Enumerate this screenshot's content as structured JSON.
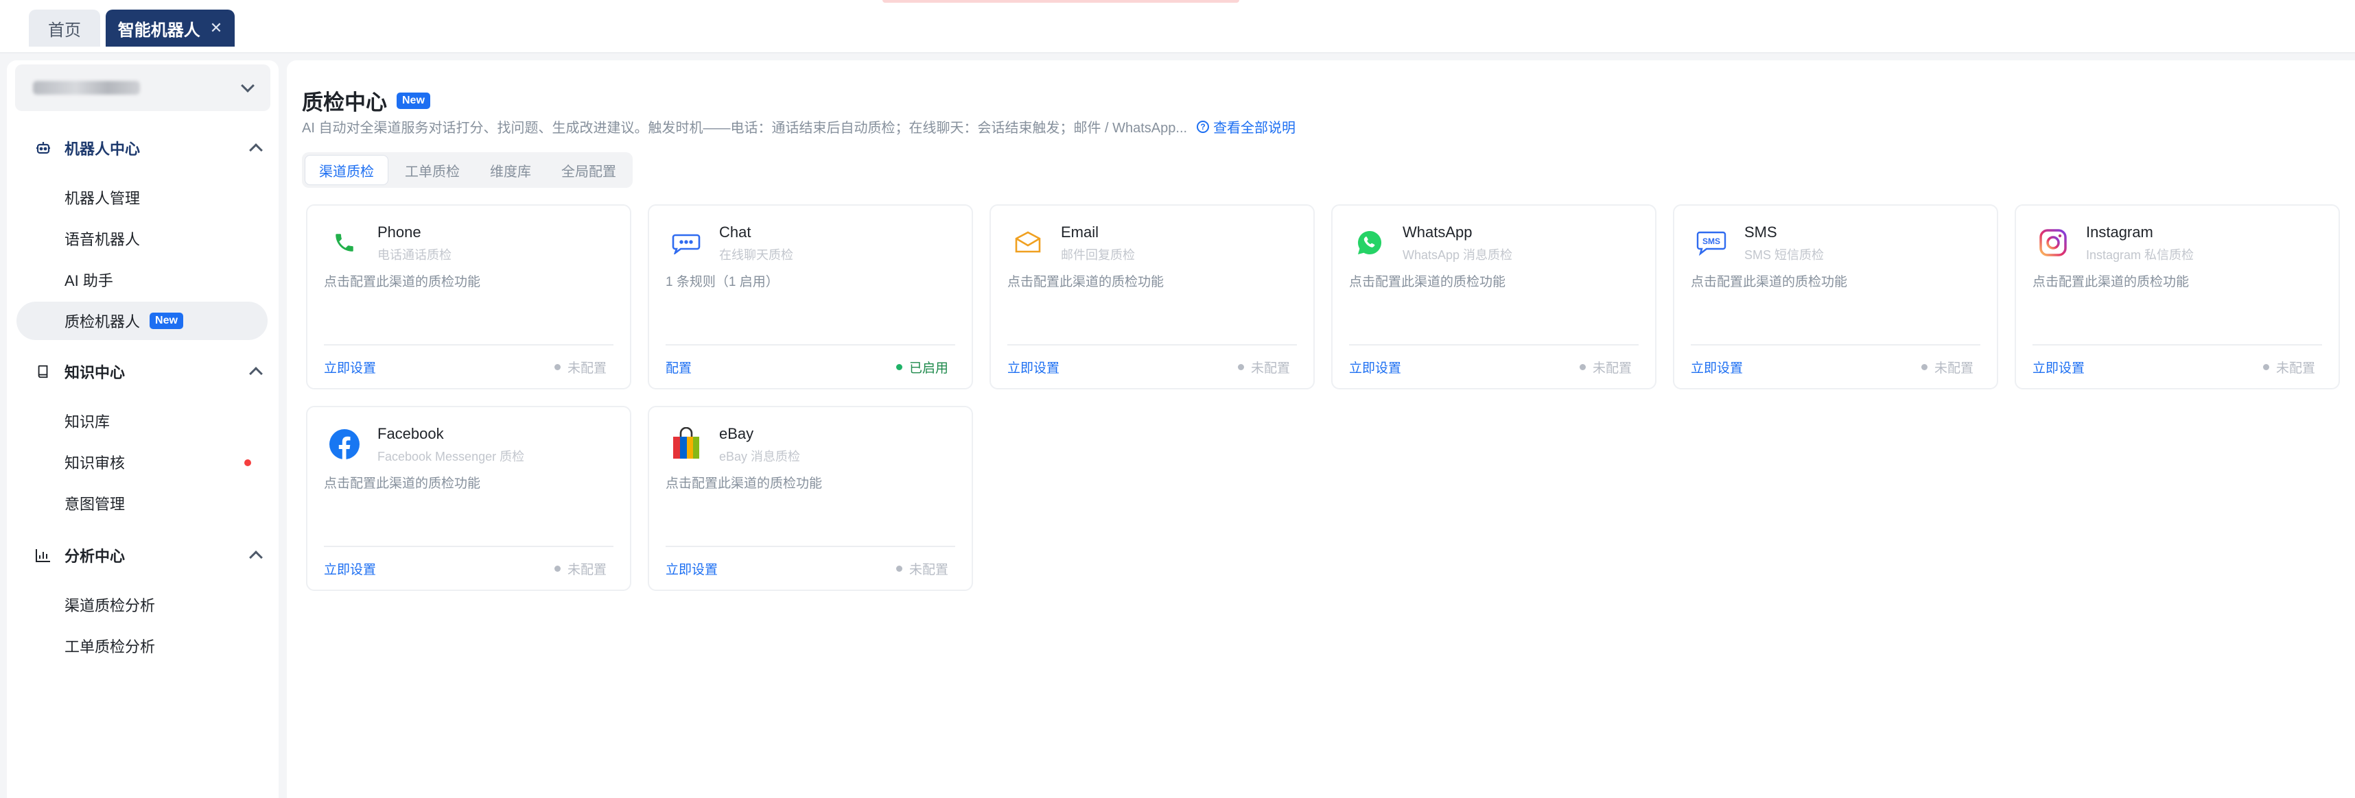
{
  "tabs": [
    {
      "label": "首页"
    },
    {
      "label": "智能机器人",
      "close": "✕"
    }
  ],
  "sidebar": {
    "groups": [
      {
        "title": "机器人中心",
        "icon": "robot-icon",
        "items": [
          {
            "label": "机器人管理"
          },
          {
            "label": "语音机器人"
          },
          {
            "label": "AI 助手"
          },
          {
            "label": "质检机器人",
            "badge": "New"
          }
        ]
      },
      {
        "title": "知识中心",
        "icon": "book-icon",
        "items": [
          {
            "label": "知识库"
          },
          {
            "label": "知识审核"
          },
          {
            "label": "意图管理"
          }
        ]
      },
      {
        "title": "分析中心",
        "icon": "bar-chart-icon",
        "items": [
          {
            "label": "渠道质检分析"
          },
          {
            "label": "工单质检分析"
          }
        ]
      }
    ]
  },
  "main": {
    "title": "质检中心",
    "title_badge": "New",
    "description": "AI 自动对全渠道服务对话打分、找问题、生成改进建议。触发时机——电话：通话结束后自动质检；在线聊天：会话结束触发；邮件 / WhatsApp...",
    "desc_link": "查看全部说明",
    "seg_tabs": [
      {
        "label": "渠道质检"
      },
      {
        "label": "工单质检"
      },
      {
        "label": "维度库"
      },
      {
        "label": "全局配置"
      }
    ],
    "cards": [
      {
        "name": "Phone",
        "sub": "电话通话质检",
        "desc": "点击配置此渠道的质检功能",
        "action": "立即设置",
        "status": "未配置",
        "icon": "phone-icon"
      },
      {
        "name": "Chat",
        "sub": "在线聊天质检",
        "desc": "1 条规则（1 启用）",
        "action": "配置",
        "status": "已启用",
        "icon": "chat-icon"
      },
      {
        "name": "Email",
        "sub": "邮件回复质检",
        "desc": "点击配置此渠道的质检功能",
        "action": "立即设置",
        "status": "未配置",
        "icon": "email-icon"
      },
      {
        "name": "WhatsApp",
        "sub": "WhatsApp 消息质检",
        "desc": "点击配置此渠道的质检功能",
        "action": "立即设置",
        "status": "未配置",
        "icon": "whatsapp-icon"
      },
      {
        "name": "SMS",
        "sub": "SMS 短信质检",
        "desc": "点击配置此渠道的质检功能",
        "action": "立即设置",
        "status": "未配置",
        "icon": "sms-icon"
      },
      {
        "name": "Instagram",
        "sub": "Instagram 私信质检",
        "desc": "点击配置此渠道的质检功能",
        "action": "立即设置",
        "status": "未配置",
        "icon": "instagram-icon"
      },
      {
        "name": "Facebook",
        "sub": "Facebook Messenger 质检",
        "desc": "点击配置此渠道的质检功能",
        "action": "立即设置",
        "status": "未配置",
        "icon": "facebook-icon"
      },
      {
        "name": "eBay",
        "sub": "eBay 消息质检",
        "desc": "点击配置此渠道的质检功能",
        "action": "立即设置",
        "status": "未配置",
        "icon": "ebay-icon"
      }
    ]
  },
  "colors": {
    "primary": "#1d6ff2",
    "tab_active_bg": "#1e3a6e",
    "enabled_green": "#1fb267",
    "alert_red": "#f53f3f"
  }
}
